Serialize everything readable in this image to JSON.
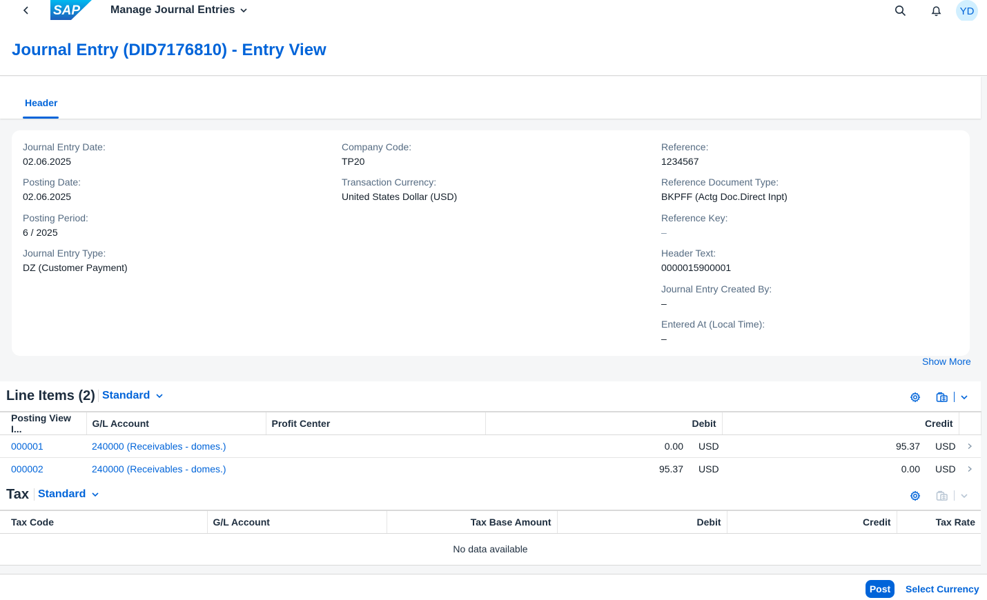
{
  "shell": {
    "logo_text": "SAP",
    "app_title": "Manage Journal Entries",
    "avatar_initials": "YD"
  },
  "page": {
    "title": "Journal Entry (DID7176810) - Entry View"
  },
  "tabs": [
    {
      "label": "Header"
    }
  ],
  "header_fields": {
    "col1": [
      {
        "label": "Journal Entry Date:",
        "value": "02.06.2025"
      },
      {
        "label": "Posting Date:",
        "value": "02.06.2025"
      },
      {
        "label": "Posting Period:",
        "value": "6 / 2025"
      },
      {
        "label": "Journal Entry Type:",
        "value": "DZ (Customer Payment)"
      }
    ],
    "col2": [
      {
        "label": "Company Code:",
        "value": "TP20"
      },
      {
        "label": "Transaction Currency:",
        "value": "United States Dollar (USD)"
      }
    ],
    "col3": [
      {
        "label": "Reference:",
        "value": "1234567"
      },
      {
        "label": "Reference Document Type:",
        "value": "BKPFF (Actg Doc.Direct Inpt)"
      },
      {
        "label": "Reference Key:",
        "value": "–"
      },
      {
        "label": "Header Text:",
        "value": "0000015900001"
      },
      {
        "label": "Journal Entry Created By:",
        "value": "–"
      },
      {
        "label": "Entered At (Local Time):",
        "value": "–"
      }
    ]
  },
  "show_more_label": "Show More",
  "line_items": {
    "title": "Line Items (2)",
    "variant": "Standard",
    "columns": [
      "Posting View I...",
      "G/L Account",
      "Profit Center",
      "Debit",
      "Credit"
    ],
    "rows": [
      {
        "item": "000001",
        "gl": "240000 (Receivables - domes.)",
        "profit_center": "",
        "debit": "0.00",
        "debit_cur": "USD",
        "credit": "95.37",
        "credit_cur": "USD"
      },
      {
        "item": "000002",
        "gl": "240000 (Receivables - domes.)",
        "profit_center": "",
        "debit": "95.37",
        "debit_cur": "USD",
        "credit": "0.00",
        "credit_cur": "USD"
      }
    ]
  },
  "tax": {
    "title": "Tax",
    "variant": "Standard",
    "columns": [
      "Tax Code",
      "G/L Account",
      "Tax Base Amount",
      "Debit",
      "Credit",
      "Tax Rate"
    ],
    "no_data": "No data available"
  },
  "footer": {
    "post_label": "Post",
    "select_currency_label": "Select Currency"
  },
  "colors": {
    "brand_blue": "#0064d9",
    "text": "#1d2d3e",
    "label": "#556b82",
    "background": "#f5f6f7"
  }
}
